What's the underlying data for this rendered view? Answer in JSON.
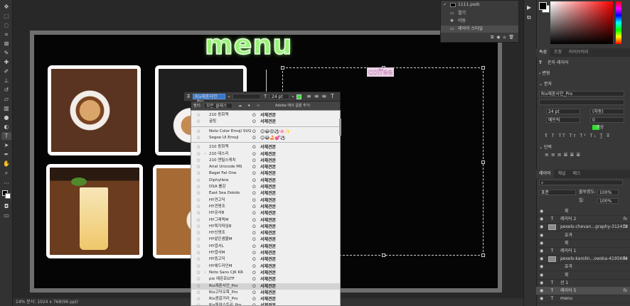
{
  "colors": {
    "title_green": "#9af27a",
    "selection": "#d3d3d3",
    "font_color_swatch": "#2fe02f",
    "layer_selected": "#4f4f4f"
  },
  "canvas": {
    "title": "menu",
    "coffee_label": "coffee"
  },
  "status": {
    "text": "14% 문서: 1024 x 768(96 ppi)"
  },
  "mini_panel": {
    "title": "1111.psdc",
    "rows": [
      "열기",
      "이동",
      "레이어 스타일"
    ]
  },
  "right_panel": {
    "tabs_properties": [
      "속성",
      "조정",
      "라이브러리"
    ],
    "subtitle": "문자 레이어",
    "sections": {
      "transform": "변형",
      "character": "문자",
      "paragraph": "단락"
    },
    "char_font": "Rix재혼사인_Pro",
    "char_size": "24 pt",
    "char_leading": "(자동)",
    "char_tracking_label": "메트릭",
    "char_tracking_value": "0",
    "color_label": "색상",
    "tabs_layers": [
      "레이어",
      "채널",
      "패스"
    ],
    "layer_mode": "표준",
    "opacity_label": "불투명도:",
    "opacity_value": "100%",
    "fill_label": "칠:",
    "fill_value": "100%",
    "layers": [
      {
        "name": "획",
        "indent": true,
        "icon": "",
        "fx": ""
      },
      {
        "name": "레이어 2",
        "indent": false,
        "icon": "T",
        "fx": "fx"
      },
      {
        "name": "pexels-chevan...graphy-312418",
        "indent": false,
        "icon": "img",
        "fx": "fx"
      },
      {
        "name": "효과",
        "indent": true,
        "icon": "",
        "fx": ""
      },
      {
        "name": "획",
        "indent": true,
        "icon": "",
        "fx": ""
      },
      {
        "name": "레이어 1",
        "indent": false,
        "icon": "T",
        "fx": ""
      },
      {
        "name": "pexels-karolin...owska-4195604",
        "indent": false,
        "icon": "img",
        "fx": "fx"
      },
      {
        "name": "효과",
        "indent": true,
        "icon": "",
        "fx": ""
      },
      {
        "name": "획",
        "indent": true,
        "icon": "",
        "fx": ""
      },
      {
        "name": "선 1",
        "indent": false,
        "icon": "T",
        "fx": ""
      },
      {
        "name": "레이어 5",
        "indent": false,
        "icon": "T",
        "fx": "fx",
        "selected": true
      },
      {
        "name": "menu",
        "indent": false,
        "icon": "T",
        "fx": ""
      }
    ]
  },
  "font_toolbar": {
    "font_field": "Rix재혼사인_Pro",
    "size_field": "24 pt"
  },
  "font_filter": {
    "filter_label": "필터:",
    "filter_value": "모든 클래스",
    "sample_label": "Adobe 에서 글꼴 추가:"
  },
  "font_list": [
    {
      "name": "210 동화책",
      "sample": "서체견본",
      "type": "O",
      "chev": false
    },
    {
      "name": "굴림",
      "sample": "서체견본",
      "type": "O",
      "chev": false
    },
    {
      "sep": true
    },
    {
      "name": "Noto Color Emoji SVG",
      "sample": "😊😂😍⚽🌸✨",
      "type": "O",
      "chev": false
    },
    {
      "name": "Segoe UI Emoji",
      "sample": "😊😂🍰💕⚽",
      "type": "O",
      "chev": false
    },
    {
      "sep": true
    },
    {
      "name": "210 동화책",
      "sample": "서체견본",
      "type": "O",
      "chev": false
    },
    {
      "name": "210 데스리",
      "sample": "서체견본",
      "type": "O",
      "chev": true
    },
    {
      "name": "210 엔틸스케치",
      "sample": "서체견본",
      "type": "O",
      "chev": false
    },
    {
      "name": "Arial Unicode MS",
      "sample": "서체견본",
      "type": "O",
      "chev": false
    },
    {
      "name": "Bagel Fat One",
      "sample": "서체견본",
      "type": "O",
      "chev": false
    },
    {
      "name": "Diphylleia",
      "sample": "서체견본",
      "type": "O",
      "chev": false
    },
    {
      "name": "DSA 롤감",
      "sample": "서체견본",
      "type": "O",
      "chev": false
    },
    {
      "name": "East Sea Dokdo",
      "sample": "서체견본",
      "type": "O",
      "chev": false
    },
    {
      "name": "HY견고딕",
      "sample": "서체견본",
      "type": "O",
      "chev": false
    },
    {
      "name": "HY견명조",
      "sample": "서체견본",
      "type": "O",
      "chev": false
    },
    {
      "name": "HY궁서B",
      "sample": "서체견본",
      "type": "O",
      "chev": false
    },
    {
      "name": "HY그래픽M",
      "sample": "서체견본",
      "type": "O",
      "chev": false
    },
    {
      "name": "HY목각파임B",
      "sample": "서체견본",
      "type": "O",
      "chev": false
    },
    {
      "name": "HY신명조",
      "sample": "서체견본",
      "type": "O",
      "chev": false
    },
    {
      "name": "HY얕은샘물M",
      "sample": "서체견본",
      "type": "O",
      "chev": false
    },
    {
      "name": "HY엽서L",
      "sample": "서체견본",
      "type": "O",
      "chev": false
    },
    {
      "name": "HY엽서M",
      "sample": "서체견본",
      "type": "O",
      "chev": false
    },
    {
      "name": "HY중고딕",
      "sample": "서체견본",
      "type": "O",
      "chev": false
    },
    {
      "name": "HY헤드라인M",
      "sample": "서체견본",
      "type": "O",
      "chev": false
    },
    {
      "name": "Noto Sans CJK KR",
      "sample": "서체견본",
      "type": "O",
      "chev": true
    },
    {
      "name": "pix 에픈로GTF",
      "sample": "서체견본",
      "type": "O",
      "chev": false
    },
    {
      "name": "Rix재혼사인_Pro",
      "sample": "서체견본",
      "type": "O",
      "chev": false,
      "selected": true
    },
    {
      "name": "Rix고딕오목_Pro",
      "sample": "서체견본",
      "type": "O",
      "chev": false
    },
    {
      "name": "Rix콩갈거리_Pro",
      "sample": "서체견본",
      "type": "O",
      "chev": false
    },
    {
      "name": "Rix독여스토리_Pro",
      "sample": "서체견본",
      "type": "O",
      "chev": false
    }
  ]
}
